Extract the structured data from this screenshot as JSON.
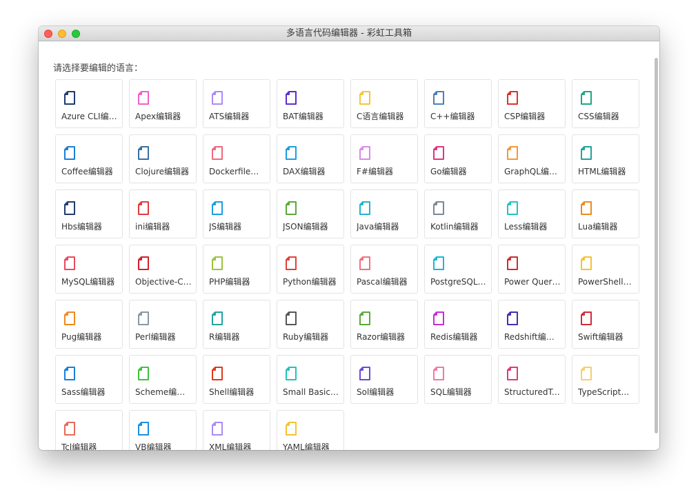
{
  "window": {
    "title": "多语言代码编辑器 - 彩虹工具箱"
  },
  "prompt": "请选择要编辑的语言：",
  "items": [
    {
      "label": "Azure CLI编辑器",
      "color": "#1f3a6e",
      "icon": "file-icon"
    },
    {
      "label": "Apex编辑器",
      "color": "#f05fc8",
      "icon": "file-icon"
    },
    {
      "label": "ATS编辑器",
      "color": "#a98af5",
      "icon": "file-icon"
    },
    {
      "label": "BAT编辑器",
      "color": "#5b2ec9",
      "icon": "file-icon"
    },
    {
      "label": "C语言编辑器",
      "color": "#f7c531",
      "icon": "file-icon"
    },
    {
      "label": "C++编辑器",
      "color": "#4a7fb8",
      "icon": "file-icon"
    },
    {
      "label": "CSP编辑器",
      "color": "#d9332a",
      "icon": "file-icon"
    },
    {
      "label": "CSS编辑器",
      "color": "#1ca87e",
      "icon": "file-icon"
    },
    {
      "label": "Coffee编辑器",
      "color": "#1a7fd6",
      "icon": "file-icon"
    },
    {
      "label": "Clojure编辑器",
      "color": "#3a6fa0",
      "icon": "file-icon"
    },
    {
      "label": "Dockerfile编辑器",
      "color": "#f2677a",
      "icon": "file-icon"
    },
    {
      "label": "DAX编辑器",
      "color": "#1a9ee0",
      "icon": "file-icon"
    },
    {
      "label": "F#编辑器",
      "color": "#d98be8",
      "icon": "file-icon"
    },
    {
      "label": "Go编辑器",
      "color": "#e0357a",
      "icon": "file-icon"
    },
    {
      "label": "GraphQL编辑器",
      "color": "#f29838",
      "icon": "file-icon"
    },
    {
      "label": "HTML编辑器",
      "color": "#1fa39e",
      "icon": "file-icon"
    },
    {
      "label": "Hbs编辑器",
      "color": "#1f3a6e",
      "icon": "file-icon"
    },
    {
      "label": "ini编辑器",
      "color": "#e03a3a",
      "icon": "file-icon"
    },
    {
      "label": "JS编辑器",
      "color": "#1a9ee0",
      "icon": "file-icon"
    },
    {
      "label": "JSON编辑器",
      "color": "#5aa83a",
      "icon": "file-icon"
    },
    {
      "label": "Java编辑器",
      "color": "#1fb3d1",
      "icon": "file-icon"
    },
    {
      "label": "Kotlin编辑器",
      "color": "#7a8796",
      "icon": "file-icon"
    },
    {
      "label": "Less编辑器",
      "color": "#1fc4c4",
      "icon": "file-icon"
    },
    {
      "label": "Lua编辑器",
      "color": "#f0881f",
      "icon": "file-icon"
    },
    {
      "label": "MySQL编辑器",
      "color": "#e84a5f",
      "icon": "file-icon"
    },
    {
      "label": "Objective-C编辑器",
      "color": "#d0202c",
      "icon": "file-icon"
    },
    {
      "label": "PHP编辑器",
      "color": "#9ac43a",
      "icon": "file-icon"
    },
    {
      "label": "Python编辑器",
      "color": "#e0403a",
      "icon": "file-icon"
    },
    {
      "label": "Pascal编辑器",
      "color": "#f2707e",
      "icon": "file-icon"
    },
    {
      "label": "PostgreSQL编辑器",
      "color": "#1ab6d8",
      "icon": "file-icon"
    },
    {
      "label": "Power Query编辑器",
      "color": "#c9302c",
      "icon": "file-icon"
    },
    {
      "label": "PowerShell编辑器",
      "color": "#f5c230",
      "icon": "file-icon"
    },
    {
      "label": "Pug编辑器",
      "color": "#f0881f",
      "icon": "file-icon"
    },
    {
      "label": "Perl编辑器",
      "color": "#8a96a6",
      "icon": "file-icon"
    },
    {
      "label": "R编辑器",
      "color": "#1fa3a0",
      "icon": "file-icon"
    },
    {
      "label": "Ruby编辑器",
      "color": "#555555",
      "icon": "file-icon"
    },
    {
      "label": "Razor编辑器",
      "color": "#5aa83a",
      "icon": "file-icon"
    },
    {
      "label": "Redis编辑器",
      "color": "#c92bd6",
      "icon": "file-icon"
    },
    {
      "label": "Redshift编辑器",
      "color": "#4a2bb0",
      "icon": "file-icon"
    },
    {
      "label": "Swift编辑器",
      "color": "#d42a38",
      "icon": "file-icon"
    },
    {
      "label": "Sass编辑器",
      "color": "#1a7fd6",
      "icon": "file-icon"
    },
    {
      "label": "Scheme编辑器",
      "color": "#3fc33a",
      "icon": "file-icon"
    },
    {
      "label": "Shell编辑器",
      "color": "#e03a1a",
      "icon": "file-icon"
    },
    {
      "label": "Small Basic编辑器",
      "color": "#1fc4b8",
      "icon": "file-icon"
    },
    {
      "label": "Sol编辑器",
      "color": "#6a4ad6",
      "icon": "file-icon"
    },
    {
      "label": "SQL编辑器",
      "color": "#f07aa0",
      "icon": "file-icon"
    },
    {
      "label": "StructuredText编辑器",
      "color": "#e03a7a",
      "icon": "file-icon"
    },
    {
      "label": "TypeScript编辑器",
      "color": "#f7cf6a",
      "icon": "file-icon"
    },
    {
      "label": "Tcl编辑器",
      "color": "#e86a5a",
      "icon": "file-icon"
    },
    {
      "label": "VB编辑器",
      "color": "#1a8fe0",
      "icon": "file-icon"
    },
    {
      "label": "XML编辑器",
      "color": "#a98af5",
      "icon": "file-icon"
    },
    {
      "label": "YAML编辑器",
      "color": "#f5c230",
      "icon": "file-icon"
    }
  ]
}
